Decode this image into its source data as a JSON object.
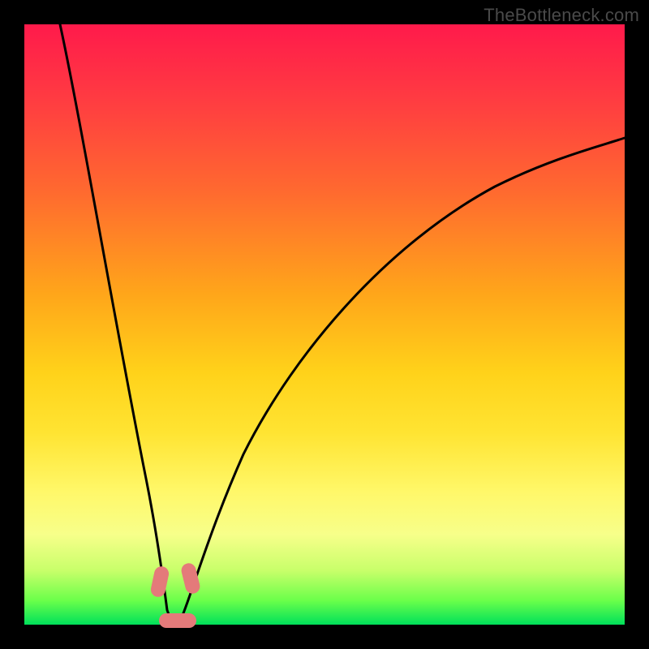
{
  "watermark": "TheBottleneck.com",
  "colors": {
    "background": "#000000",
    "gradient_top": "#ff1a4b",
    "gradient_mid": "#ffd21a",
    "gradient_bottom": "#00e05a",
    "curve": "#000000",
    "marker": "#e47a7a"
  },
  "chart_data": {
    "type": "line",
    "title": "",
    "xlabel": "",
    "ylabel": "",
    "xlim": [
      0,
      100
    ],
    "ylim": [
      0,
      100
    ],
    "note": "Y axis inverted visually: 0 at bottom (green / low bottleneck), 100 at top (red / severe bottleneck). Chart has no numeric axis labels.",
    "series": [
      {
        "name": "left-curve",
        "x": [
          6,
          8,
          10,
          12,
          14,
          16,
          18,
          20,
          21,
          22,
          23,
          24,
          25
        ],
        "y": [
          100,
          88,
          76,
          64,
          52,
          40,
          28,
          14,
          7.5,
          2.5,
          0,
          0,
          0
        ]
      },
      {
        "name": "right-curve",
        "x": [
          25,
          26,
          27,
          28,
          30,
          33,
          37,
          42,
          48,
          56,
          66,
          80,
          100
        ],
        "y": [
          0,
          0,
          0,
          2.5,
          7.5,
          16,
          27,
          38,
          48,
          58,
          67,
          75,
          81
        ]
      }
    ],
    "markers": [
      {
        "name": "left-curve-marker",
        "x": 21.5,
        "y": 6
      },
      {
        "name": "right-curve-marker",
        "x": 27.5,
        "y": 6
      },
      {
        "name": "trough-marker",
        "x": 24.5,
        "y": 0
      }
    ]
  }
}
